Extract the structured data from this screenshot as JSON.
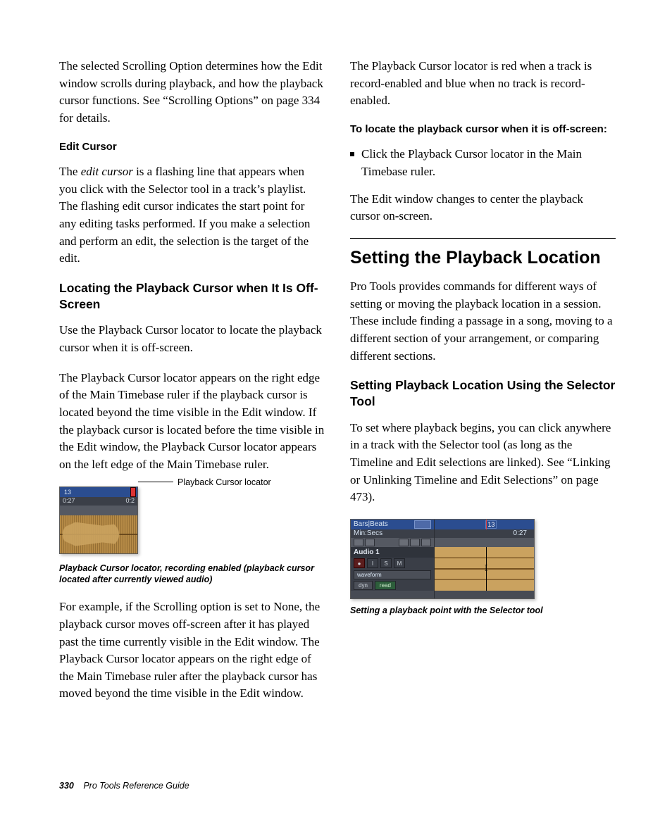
{
  "left": {
    "p_scroll": "The selected Scrolling Option determines how the Edit window scrolls during playback, and how the playback cursor functions. See “Scrolling Options” on page 334 for details.",
    "h_edit_cursor": "Edit Cursor",
    "p_edit_cursor_pre": "The ",
    "term_edit_cursor": "edit cursor",
    "p_edit_cursor_post": " is a flashing line that appears when you click with the Selector tool in a track’s playlist. The flashing edit cursor indicates the start point for any editing tasks performed. If you make a selection and perform an edit, the selection is the target of the edit.",
    "h_locating": "Locating the Playback Cursor when It Is Off-Screen",
    "p_locate1": "Use the Playback Cursor locator to locate the playback cursor when it is off-screen.",
    "p_locate2": "The Playback Cursor locator appears on the right edge of the Main Timebase ruler if the playback cursor is located beyond the time visible in the Edit window. If the playback cursor is located before the time visible in the Edit window, the Playback Cursor locator appears on the left edge of the Main Timebase ruler.",
    "fig1": {
      "marker": "13",
      "time_left": "0:27",
      "time_right": "0:2",
      "callout": "Playback Cursor locator",
      "caption": "Playback Cursor locator, recording enabled (playback cursor located after currently viewed audio)"
    },
    "p_example": "For example, if the Scrolling option is set to None, the playback cursor moves off-screen after it has played past the time currently visible in the Edit window. The Playback Cursor locator appears on the right edge of the Main Timebase ruler after the playback cursor has moved beyond the time visible in the Edit window."
  },
  "right": {
    "p_color": "The Playback Cursor locator is red when a track is record-enabled and blue when no track is record-enabled.",
    "h_to_locate": "To locate the playback cursor when it is off-screen:",
    "step1": "Click the Playback Cursor locator in the Main Timebase ruler.",
    "p_center": "The Edit window changes to center the playback cursor on-screen.",
    "h2": "Setting the Playback Location",
    "p_commands": "Pro Tools provides commands for different ways of setting or moving the playback location in a session. These include finding a passage in a song, moving to a different section of your arrangement, or comparing different sections.",
    "h3": "Setting Playback Location Using the Selector Tool",
    "p_selector": "To set where playback begins, you can click anywhere in a track with the Selector tool (as long as the Timeline and Edit selections are linked). See “Linking or Unlinking Timeline and Edit Selections” on page 473).",
    "fig2": {
      "bars_beats": "Bars|Beats",
      "min_secs": "Min:Secs",
      "track_name": "Audio 1",
      "btn_rec": "●",
      "btn_i": "I",
      "btn_s": "S",
      "btn_m": "M",
      "view": "waveform",
      "dyn": "dyn",
      "read": "read",
      "marker": "13",
      "time": "0:27",
      "caption": "Setting a playback point with the Selector tool"
    }
  },
  "footer": {
    "page": "330",
    "book": "Pro Tools Reference Guide"
  }
}
